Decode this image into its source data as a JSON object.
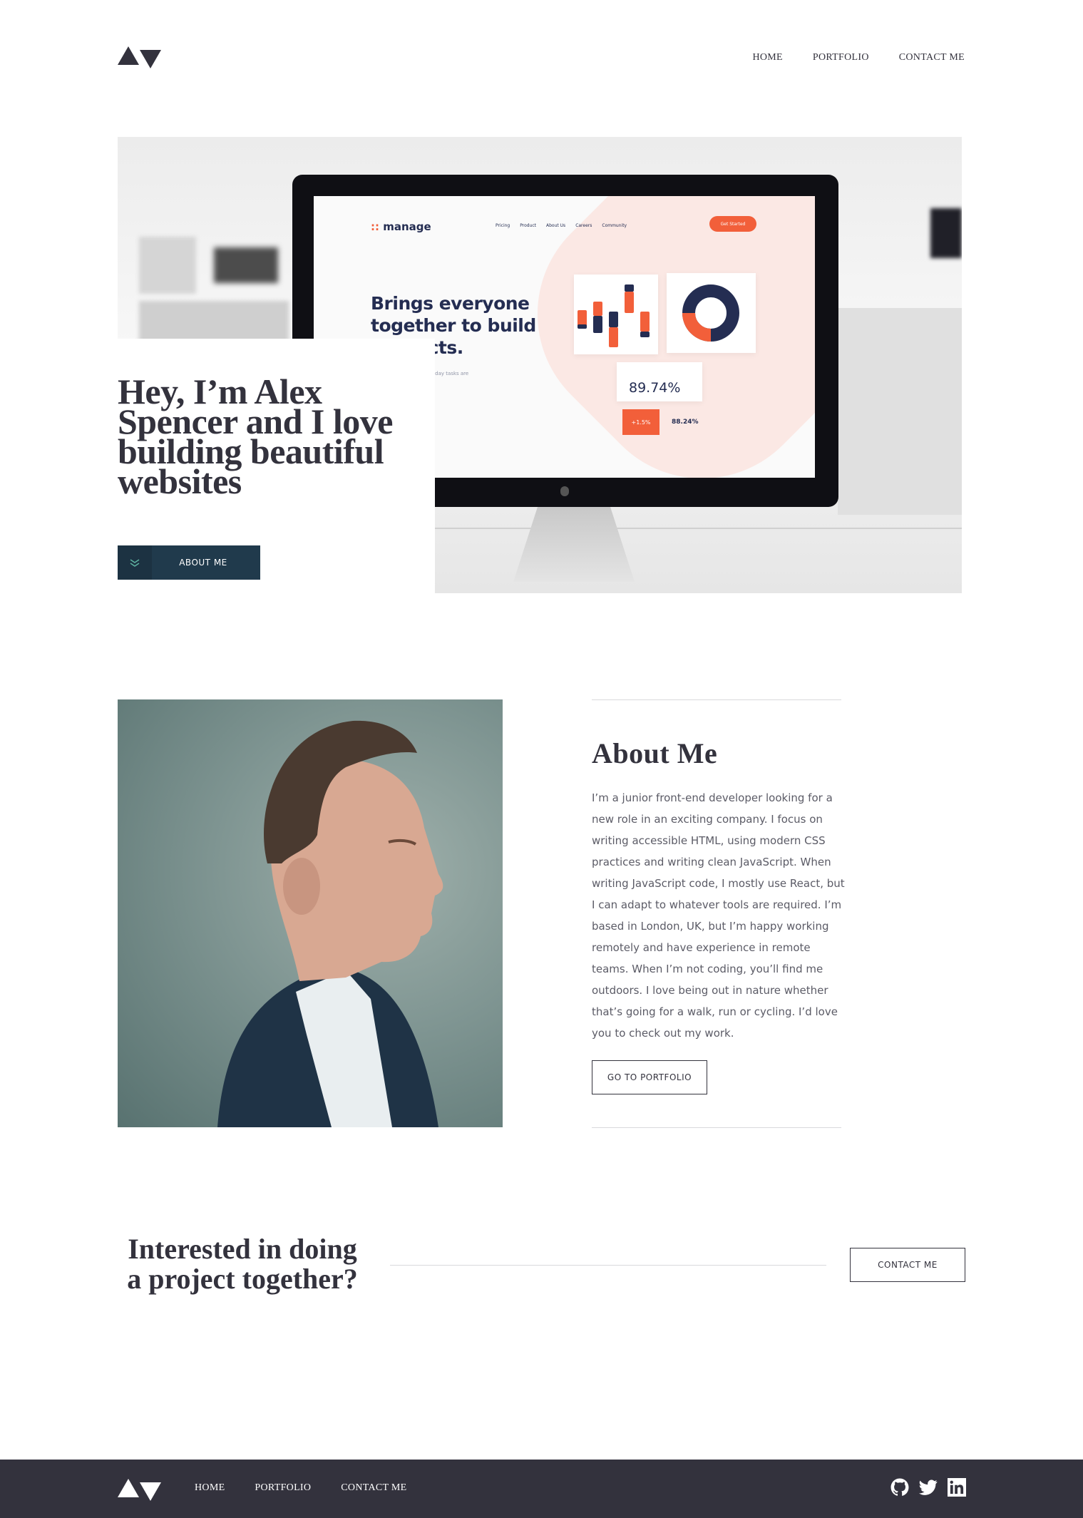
{
  "nav": {
    "home": "HOME",
    "portfolio": "PORTFOLIO",
    "contact": "CONTACT ME"
  },
  "hero": {
    "title": "Hey, I’m Alex Spencer and I love building beautiful websites",
    "button_label": "ABOUT ME",
    "mock": {
      "logo": "manage",
      "nav": [
        "Pricing",
        "Product",
        "About Us",
        "Careers",
        "Community"
      ],
      "cta": "Get Started",
      "headline": "Brings everyone together to build products.",
      "sub": "mple for software e everyday tasks are arger goal.",
      "stat_main": "89.74%",
      "stat_red": "+1.5%",
      "stat_small": "88.24%"
    }
  },
  "about": {
    "title": "About Me",
    "text": "I’m a junior front-end developer looking for a new role in an exciting company. I focus on writing accessible HTML, using modern CSS practices and writing clean JavaScript. When writing JavaScript code, I mostly use React, but I can adapt to whatever tools are required. I’m based in London, UK, but I’m happy working remotely and have experience in remote teams. When I’m not coding, you’ll find me outdoors. I love being out in nature whether that’s going for a walk, run or cycling. I’d love you to check out my work.",
    "button_label": "GO TO PORTFOLIO"
  },
  "cta": {
    "title": "Interested in doing a project together?",
    "button_label": "CONTACT ME"
  },
  "footer": {
    "home": "HOME",
    "portfolio": "PORTFOLIO",
    "contact": "CONTACT ME"
  },
  "colors": {
    "dark": "#33323d",
    "navy": "#203a4c",
    "accent": "#f25f3a"
  }
}
